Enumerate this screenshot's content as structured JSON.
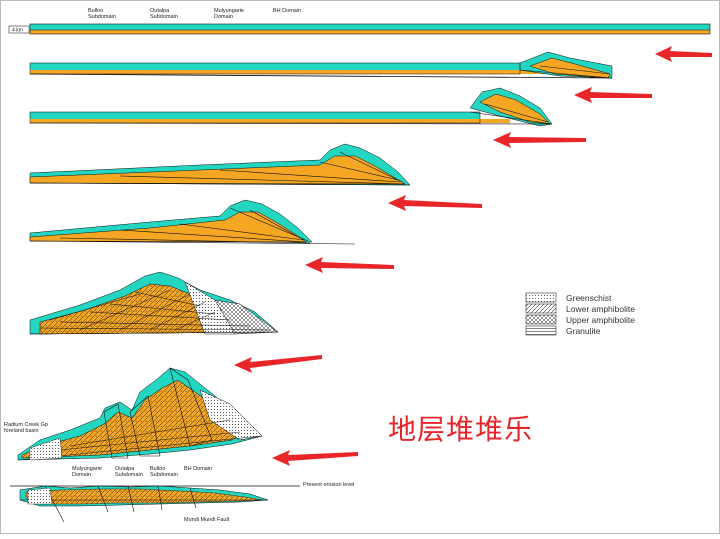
{
  "colors": {
    "cyan": "#22d6c2",
    "orange": "#f5a623",
    "arrow": "#e8262a",
    "line": "#111111"
  },
  "top_labels": [
    {
      "id": "bulloo",
      "text": "Bulloo\nSubdomain"
    },
    {
      "id": "outalpa",
      "text": "Outalpa\nSubdomain"
    },
    {
      "id": "mulyungarie",
      "text": "Mulyungarie\nDomain"
    },
    {
      "id": "bh",
      "text": "BH Domain"
    }
  ],
  "scale_label": "4 km",
  "legend": [
    {
      "label": "Greenschist",
      "pattern": "dots"
    },
    {
      "label": "Lower amphibolite",
      "pattern": "diag"
    },
    {
      "label": "Upper amphibolite",
      "pattern": "cross"
    },
    {
      "label": "Granulite",
      "pattern": "horiz"
    }
  ],
  "bottom_labels": {
    "radium": "Radium Creek Gp\nforeland basin",
    "mulyungarie": "Mulyungarie\nDomain",
    "outalpa": "Outalpa\nSubdomain",
    "bulloo": "Bulloo\nSubdomain",
    "bh": "BH Domain",
    "erosion": "Present erosion level",
    "fault": "Mundi Mundi Fault"
  },
  "title": "地层堆堆乐",
  "arrows": [
    1,
    2,
    3,
    4,
    5,
    6,
    7
  ]
}
